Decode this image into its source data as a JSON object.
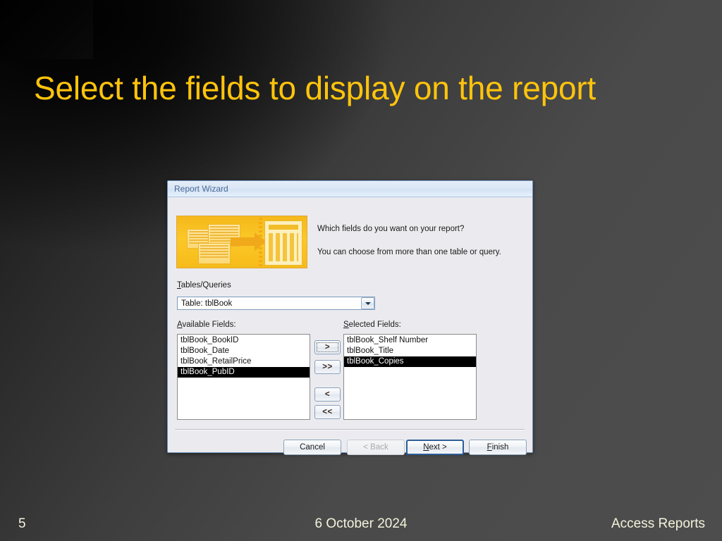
{
  "slide": {
    "title": "Select the fields to display on the report",
    "title_color": "#ffc40c",
    "background_color": "#4a4a4a",
    "footer": {
      "slide_number": "5",
      "date": "6 October 2024",
      "deck_name": "Access Reports",
      "text_color": "#f3f3dc"
    }
  },
  "dialog": {
    "title": "Report Wizard",
    "titlebar_color": "#dae7f6",
    "body_color": "#ebebef",
    "icon_name": "report-wizard-icon",
    "icon_color": "#fbc828",
    "prompt_line1": "Which fields do you want on your report?",
    "prompt_line2": "You can choose from more than one table or query.",
    "tables_queries": {
      "label": "Tables/Queries",
      "accelerator": "T",
      "selected_value": "Table: tblBook",
      "dropdown_icon": "chevron-down-icon"
    },
    "available_fields": {
      "label": "Available Fields:",
      "accelerator": "A",
      "items": [
        {
          "text": "tblBook_BookID",
          "selected": false
        },
        {
          "text": "tblBook_Date",
          "selected": false
        },
        {
          "text": "tblBook_RetailPrice",
          "selected": false
        },
        {
          "text": "tblBook_PubID",
          "selected": true
        }
      ]
    },
    "selected_fields": {
      "label": "Selected Fields:",
      "accelerator": "S",
      "items": [
        {
          "text": "tblBook_Shelf Number",
          "selected": false
        },
        {
          "text": "tblBook_Title",
          "selected": false
        },
        {
          "text": "tblBook_Copies",
          "selected": true
        }
      ]
    },
    "transfer_buttons": [
      {
        "label": ">",
        "name": "move-one-right-button",
        "focused": true
      },
      {
        "label": ">>",
        "name": "move-all-right-button",
        "focused": false
      },
      {
        "label": "<",
        "name": "move-one-left-button",
        "focused": false
      },
      {
        "label": "<<",
        "name": "move-all-left-button",
        "focused": false
      }
    ],
    "buttons": {
      "cancel": "Cancel",
      "back": "< Back",
      "next": "Next >",
      "finish": "Finish",
      "back_disabled": true,
      "next_is_default": true,
      "default_border_color": "#2c5e99"
    }
  }
}
